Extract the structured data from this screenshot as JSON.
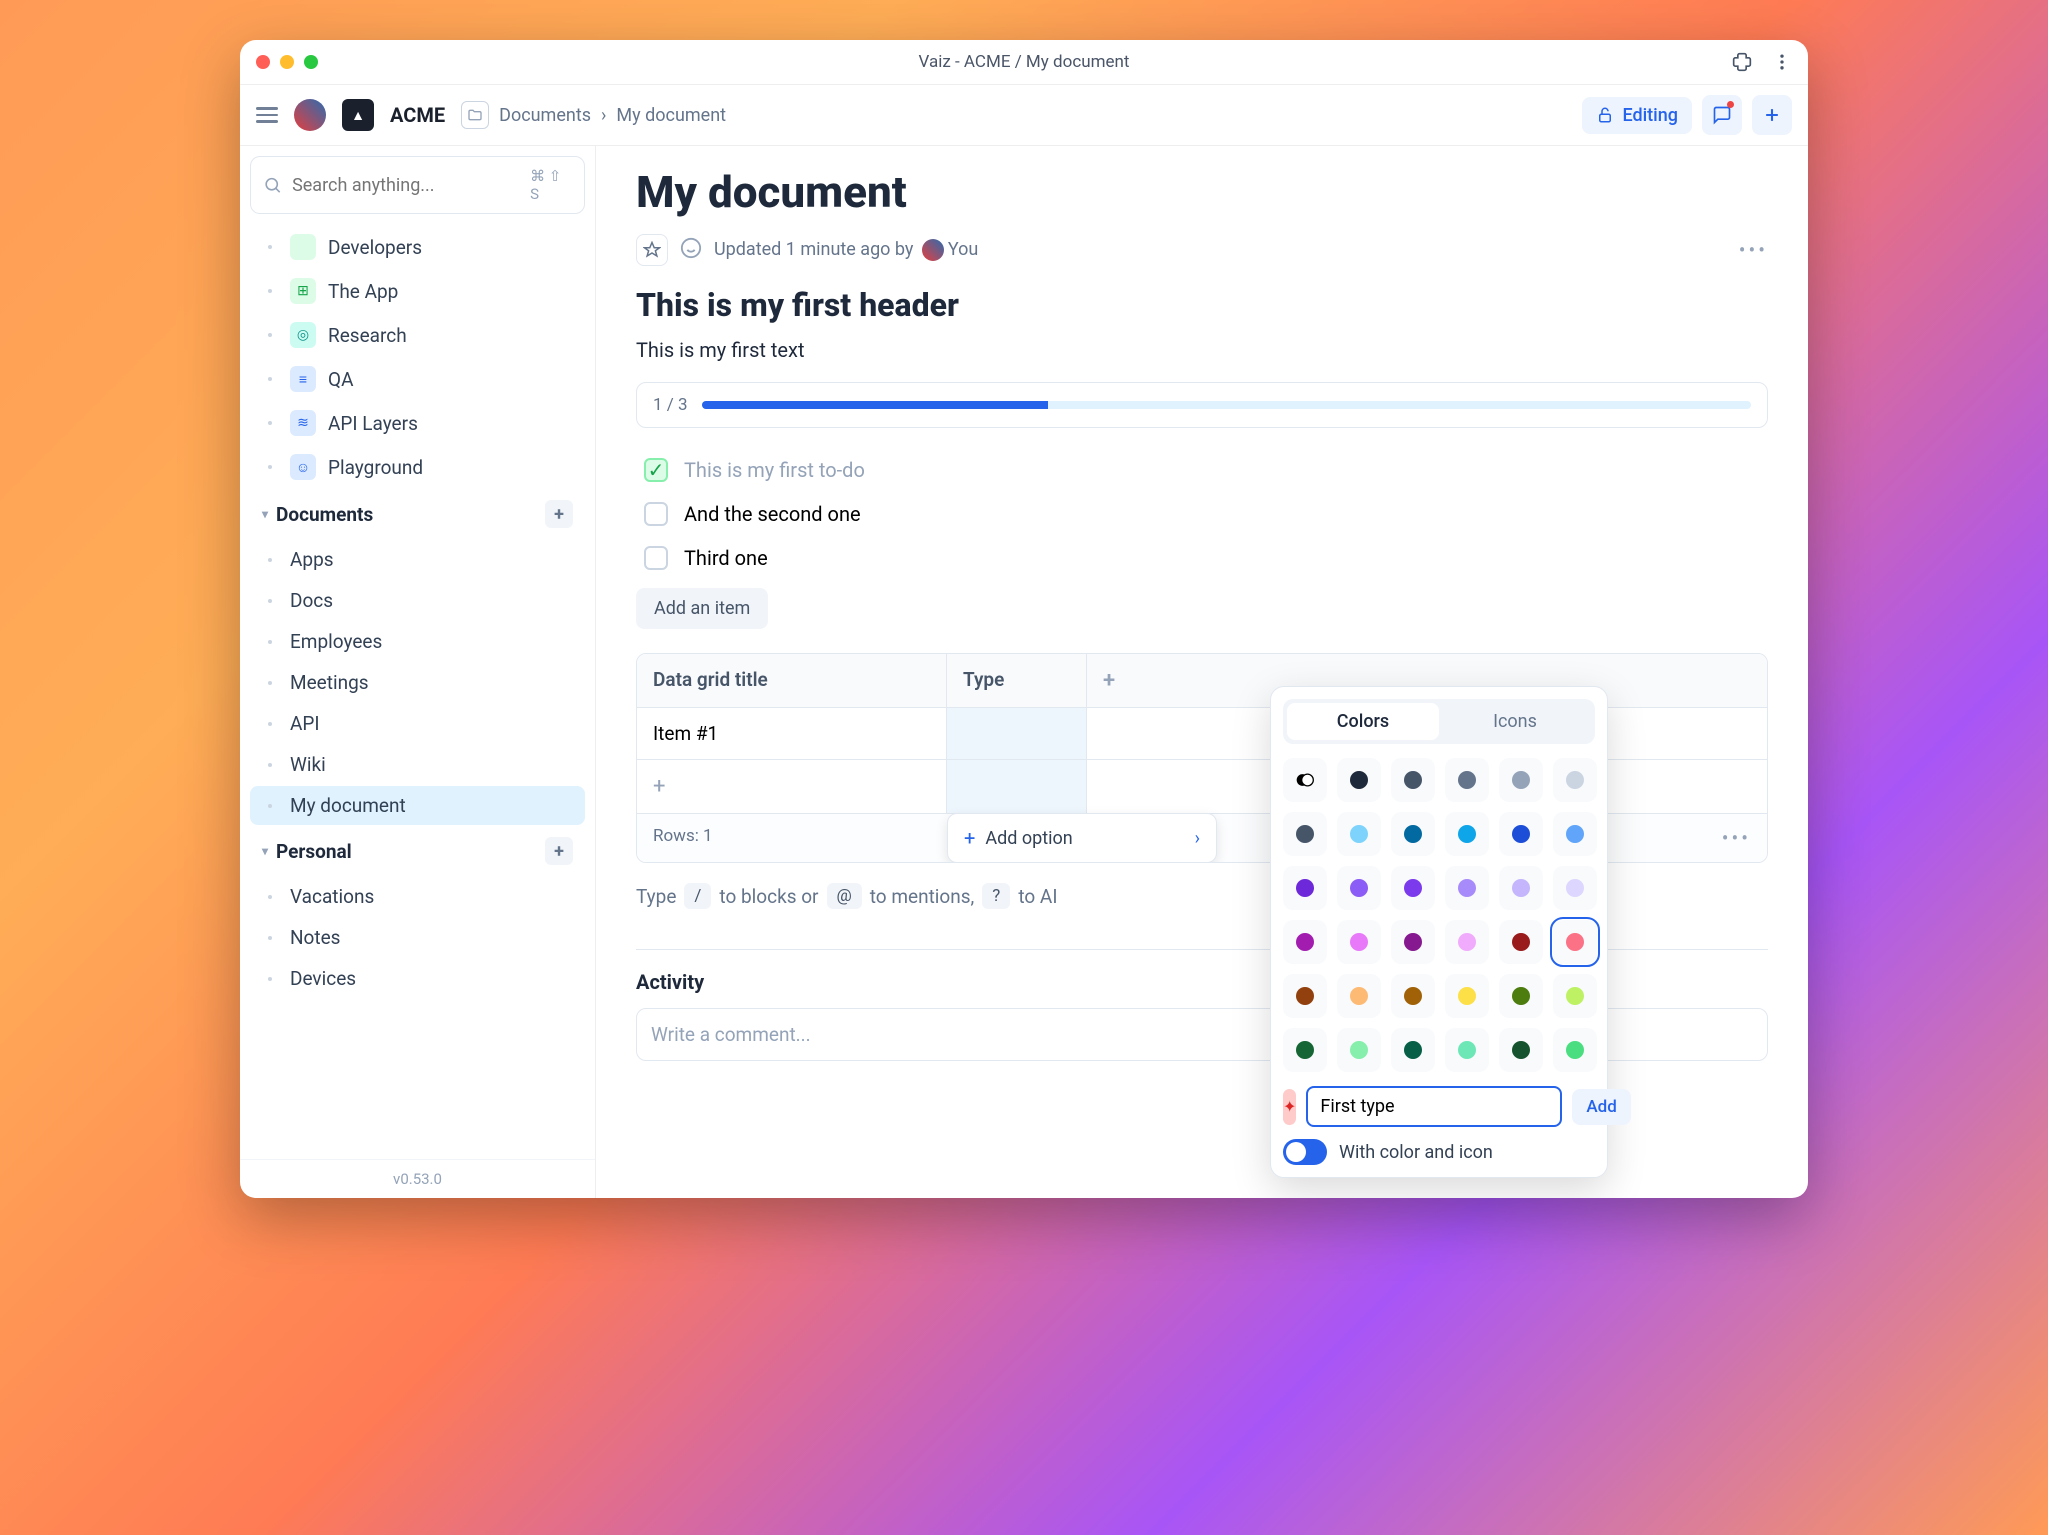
{
  "window": {
    "title": "Vaiz - ACME / My document"
  },
  "workspace": {
    "name": "ACME"
  },
  "breadcrumb": {
    "root": "Documents",
    "current": "My document"
  },
  "topbar": {
    "edit_label": "Editing"
  },
  "search": {
    "placeholder": "Search anything...",
    "shortcut": "⌘ ⇧ S"
  },
  "sidebar": {
    "topItems": [
      {
        "label": "Developers",
        "iconClass": "i-green",
        "glyph": "</>"
      },
      {
        "label": "The App",
        "iconClass": "i-green",
        "glyph": "⊞"
      },
      {
        "label": "Research",
        "iconClass": "i-teal",
        "glyph": "◎"
      },
      {
        "label": "QA",
        "iconClass": "i-blue",
        "glyph": "≡"
      },
      {
        "label": "API Layers",
        "iconClass": "i-blue",
        "glyph": "≋"
      },
      {
        "label": "Playground",
        "iconClass": "i-blue",
        "glyph": "☺"
      }
    ],
    "sections": [
      {
        "title": "Documents",
        "items": [
          {
            "label": "Apps"
          },
          {
            "label": "Docs"
          },
          {
            "label": "Employees"
          },
          {
            "label": "Meetings"
          },
          {
            "label": "API"
          },
          {
            "label": "Wiki"
          },
          {
            "label": "My document",
            "active": true
          }
        ]
      },
      {
        "title": "Personal",
        "items": [
          {
            "label": "Vacations"
          },
          {
            "label": "Notes"
          },
          {
            "label": "Devices"
          }
        ]
      }
    ],
    "version": "v0.53.0"
  },
  "doc": {
    "title": "My document",
    "updated": "Updated 1 minute ago by ",
    "author": "You",
    "header1": "This is my first header",
    "text1": "This is my first text",
    "progress": {
      "label": "1 / 3",
      "percent": 33
    },
    "todos": [
      {
        "label": "This is my first to-do",
        "done": true
      },
      {
        "label": "And the second one",
        "done": false
      },
      {
        "label": "Third one",
        "done": false
      }
    ],
    "addItem": "Add an item",
    "grid": {
      "columns": [
        "Data grid title",
        "Type"
      ],
      "rows": [
        {
          "c0": "Item #1",
          "c1": ""
        }
      ],
      "footer": "Rows: 1",
      "addOption": "Add option"
    },
    "hint": {
      "pre": "Type",
      "k1": "/",
      "mid1": "to blocks or",
      "k2": "@",
      "mid2": "to mentions,",
      "k3": "?",
      "mid3": "to AI"
    },
    "activity": {
      "title": "Activity",
      "placeholder": "Write a comment..."
    }
  },
  "picker": {
    "tabs": {
      "colors": "Colors",
      "icons": "Icons"
    },
    "inputValue": "First type",
    "addLabel": "Add",
    "toggleLabel": "With color and icon",
    "swatches": [
      "bw",
      "#1e293b",
      "#475569",
      "#64748b",
      "#94a3b8",
      "#cbd5e1",
      "#475569",
      "#7dd3fc",
      "#0369a1",
      "#0ea5e9",
      "#1d4ed8",
      "#60a5fa",
      "#6d28d9",
      "#8b5cf6",
      "#7c3aed",
      "#a78bfa",
      "#c4b5fd",
      "#ddd6fe",
      "#a21caf",
      "#e879f9",
      "#86198f",
      "#f0abfc",
      "#991b1b",
      "#fb7185",
      "#92400e",
      "#fdba74",
      "#a16207",
      "#fde047",
      "#4d7c0f",
      "#bef264",
      "#166534",
      "#86efac",
      "#065f46",
      "#6ee7b7",
      "#14532d",
      "#4ade80"
    ],
    "selectedIndex": 23
  }
}
